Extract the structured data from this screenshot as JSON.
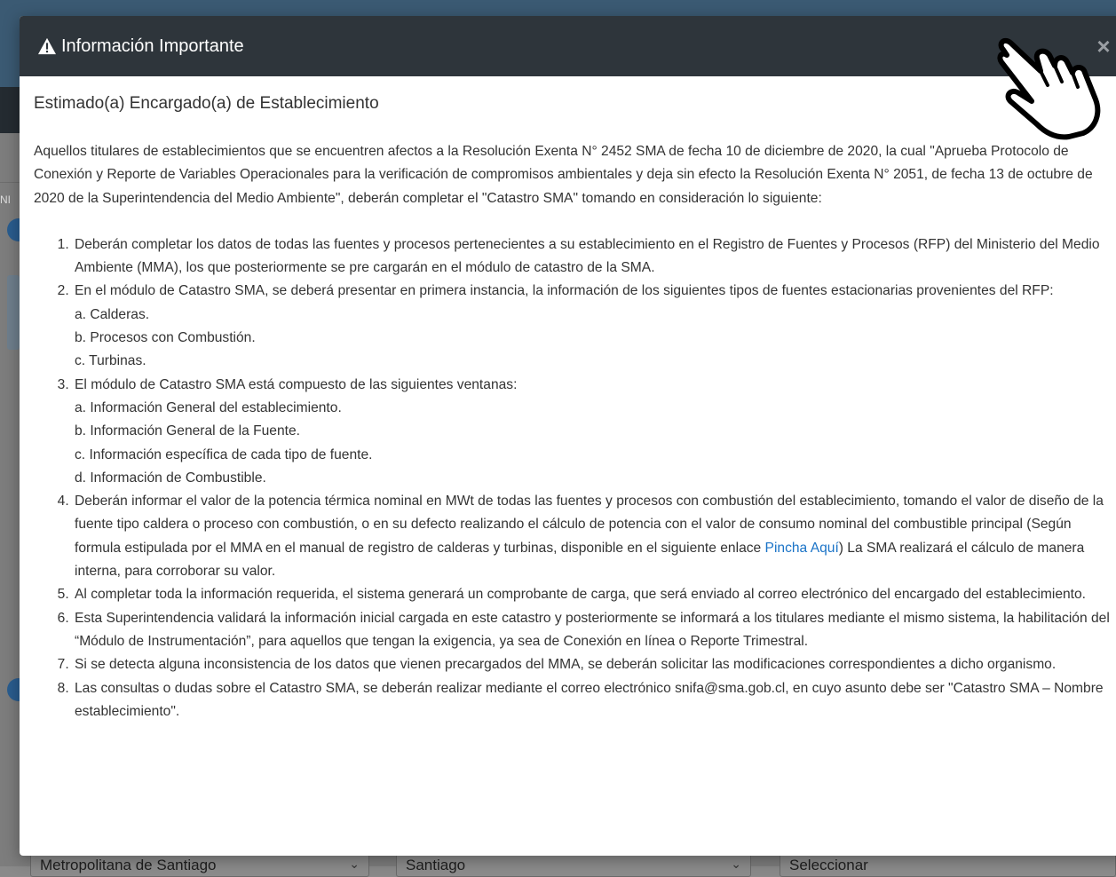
{
  "background": {
    "nav_fragment": "NI",
    "selects": [
      {
        "value": "Metropolitana de Santiago"
      },
      {
        "value": "Santiago"
      },
      {
        "value": "Seleccionar"
      }
    ]
  },
  "modal": {
    "title": "Información Importante",
    "close_label": "×",
    "greeting": "Estimado(a) Encargado(a) de Establecimiento",
    "intro": "Aquellos titulares de establecimientos que se encuentren afectos a la Resolución Exenta N° 2452 SMA de fecha 10 de diciembre de 2020, la cual \"Aprueba Protocolo de Conexión y Reporte de Variables Operacionales para la verificación de compromisos ambientales y deja sin efecto la Resolución Exenta N° 2051, de fecha 13 de octubre de 2020 de la Superintendencia del Medio Ambiente\", deberán completar el \"Catastro SMA\" tomando en consideración lo siguiente:",
    "steps": {
      "s1": "Deberán completar los datos de todas las fuentes y procesos pertenecientes a su establecimiento en el Registro de Fuentes y Procesos (RFP) del Ministerio del Medio Ambiente (MMA), los que posteriormente se pre cargarán en el módulo de catastro de la SMA.",
      "s2": "En el módulo de Catastro SMA, se deberá presentar en primera instancia, la información de los siguientes tipos de fuentes estacionarias provenientes del RFP:",
      "s2a": "a. Calderas.",
      "s2b": "b. Procesos con Combustión.",
      "s2c": "c. Turbinas.",
      "s3": "El módulo de Catastro SMA está compuesto de las siguientes ventanas:",
      "s3a": "a. Información General del establecimiento.",
      "s3b": "b. Información General de la Fuente.",
      "s3c": "c. Información específica de cada tipo de fuente.",
      "s3d": "d. Información de Combustible.",
      "s4_pre": "Deberán informar el valor de la potencia térmica nominal en MWt de todas las fuentes y procesos con combustión del establecimiento, tomando el valor de diseño de la fuente tipo caldera o proceso con combustión, o en su defecto realizando el cálculo de potencia con el valor de consumo nominal del combustible principal (Según formula estipulada por el MMA en el manual de registro de calderas y turbinas, disponible en el siguiente enlace ",
      "s4_link": "Pincha Aquí",
      "s4_post": ") La SMA realizará el cálculo de manera interna, para corroborar su valor.",
      "s5": "Al completar toda la información requerida, el sistema generará un comprobante de carga, que será enviado al correo electrónico del encargado del establecimiento.",
      "s6": "Esta Superintendencia validará la información inicial cargada en este catastro y posteriormente se informará a los titulares mediante el mismo sistema, la habilitación del “Módulo de Instrumentación”, para aquellos que tengan la exigencia, ya sea de Conexión en línea o Reporte Trimestral.",
      "s7": "Si se detecta alguna inconsistencia de los datos que vienen precargados del MMA, se deberán solicitar las modificaciones correspondientes a dicho organismo.",
      "s8": "Las consultas o dudas sobre el Catastro SMA, se deberán realizar mediante el correo electrónico snifa@sma.gob.cl, en cuyo asunto debe ser \"Catastro SMA – Nombre establecimiento\"."
    }
  },
  "colors": {
    "header_bg": "#2e353b",
    "link": "#1a73c7",
    "backdrop": "#7d7d7d"
  },
  "icons": [
    "warning-icon",
    "close-icon",
    "pointing-hand-icon"
  ]
}
